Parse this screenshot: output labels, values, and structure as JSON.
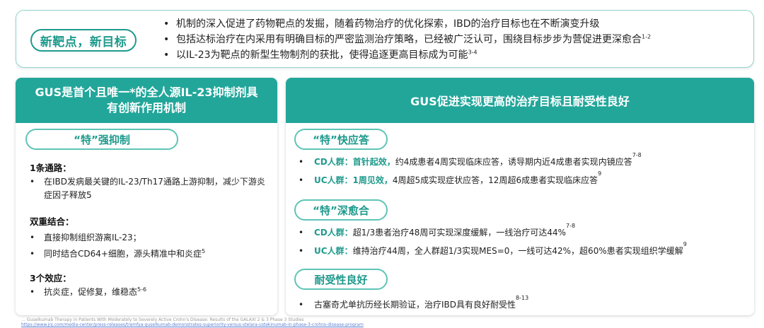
{
  "top": {
    "pill": "新靶点，新目标",
    "bullets": [
      {
        "text": "机制的深入促进了药物靶点的发掘，随着药物治疗的优化探索，IBD的治疗目标也在不断演变升级",
        "sup": ""
      },
      {
        "text": "包括达标治疗在内采用有明确目标的严密监测治疗策略，已经被广泛认可，围绕目标步步为营促进更深愈合",
        "sup": "1-2"
      },
      {
        "text": "以IL-23为靶点的新型生物制剂的获批，使得追逐更高目标成为可能",
        "sup": "3-4"
      }
    ]
  },
  "left": {
    "title": "GUS是首个且唯一*的全人源IL-23抑制剂具有创新作用机制",
    "pill": "“特”强抑制",
    "sec1": {
      "title": "1条通路：",
      "items": [
        {
          "text": "在IBD发病最关键的IL-23/Th17通路上游抑制，减少下游炎症因子释放5",
          "sup": ""
        }
      ]
    },
    "sec2": {
      "title": "双重结合：",
      "items": [
        {
          "text": "直接抑制组织游离IL-23；",
          "sup": ""
        },
        {
          "text": "同时结合CD64+细胞，源头精准中和炎症",
          "sup": "5"
        }
      ]
    },
    "sec3": {
      "title": "3个效应：",
      "items": [
        {
          "text": "抗炎症，促修复，维稳态",
          "sup": "5-6"
        }
      ]
    }
  },
  "right": {
    "title": "GUS促进实现更高的治疗目标且耐受性良好",
    "pill1": "“特”快应答",
    "row1": {
      "label": "CD人群：首针起效，",
      "text": "约4成患者4周实现临床应答，诱导期内近4成患者实现内镜应答",
      "sup": "7-8"
    },
    "row2": {
      "label": "UC人群：1周见效，",
      "text": "4周超5成实现症状应答，12周超6成患者实现临床应答",
      "sup": "9"
    },
    "pill2": "“特”深愈合",
    "row3": {
      "label": "CD人群：",
      "text": "超1/3患者治疗48周可实现深度缓解，一线治疗可达44%",
      "sup": "7-8"
    },
    "row4": {
      "label": "UC人群：",
      "text": "维持治疗44周，全人群超1/3实现MES=0，一线可达42%，超60%患者实现组织学缓解",
      "sup": "9"
    },
    "pill3": "耐受性良好",
    "row5": {
      "label": "",
      "text": "古塞奇尤单抗历经长期验证，治疗IBD具有良好耐受性",
      "sup": "8-13"
    }
  },
  "footnote": {
    "line1": "… Guselkumab Therapy in Patients With Moderately to Severely Active Crohn's Disease: Results of the GALAXI 2 & 3 Phase 3 Studies",
    "line2": "https://www.jnj.com/media-center/press-releases/tremfya-guselkumab-demonstrates-superiority-versus-stelara-ustekinumab-in-phase-3-crohns-disease-program"
  },
  "colors": {
    "accent": "#22a69a",
    "accent_text": "#1e9a8c",
    "pill_border": "#5fc4b7",
    "banner_border": "#8fd3cb"
  }
}
